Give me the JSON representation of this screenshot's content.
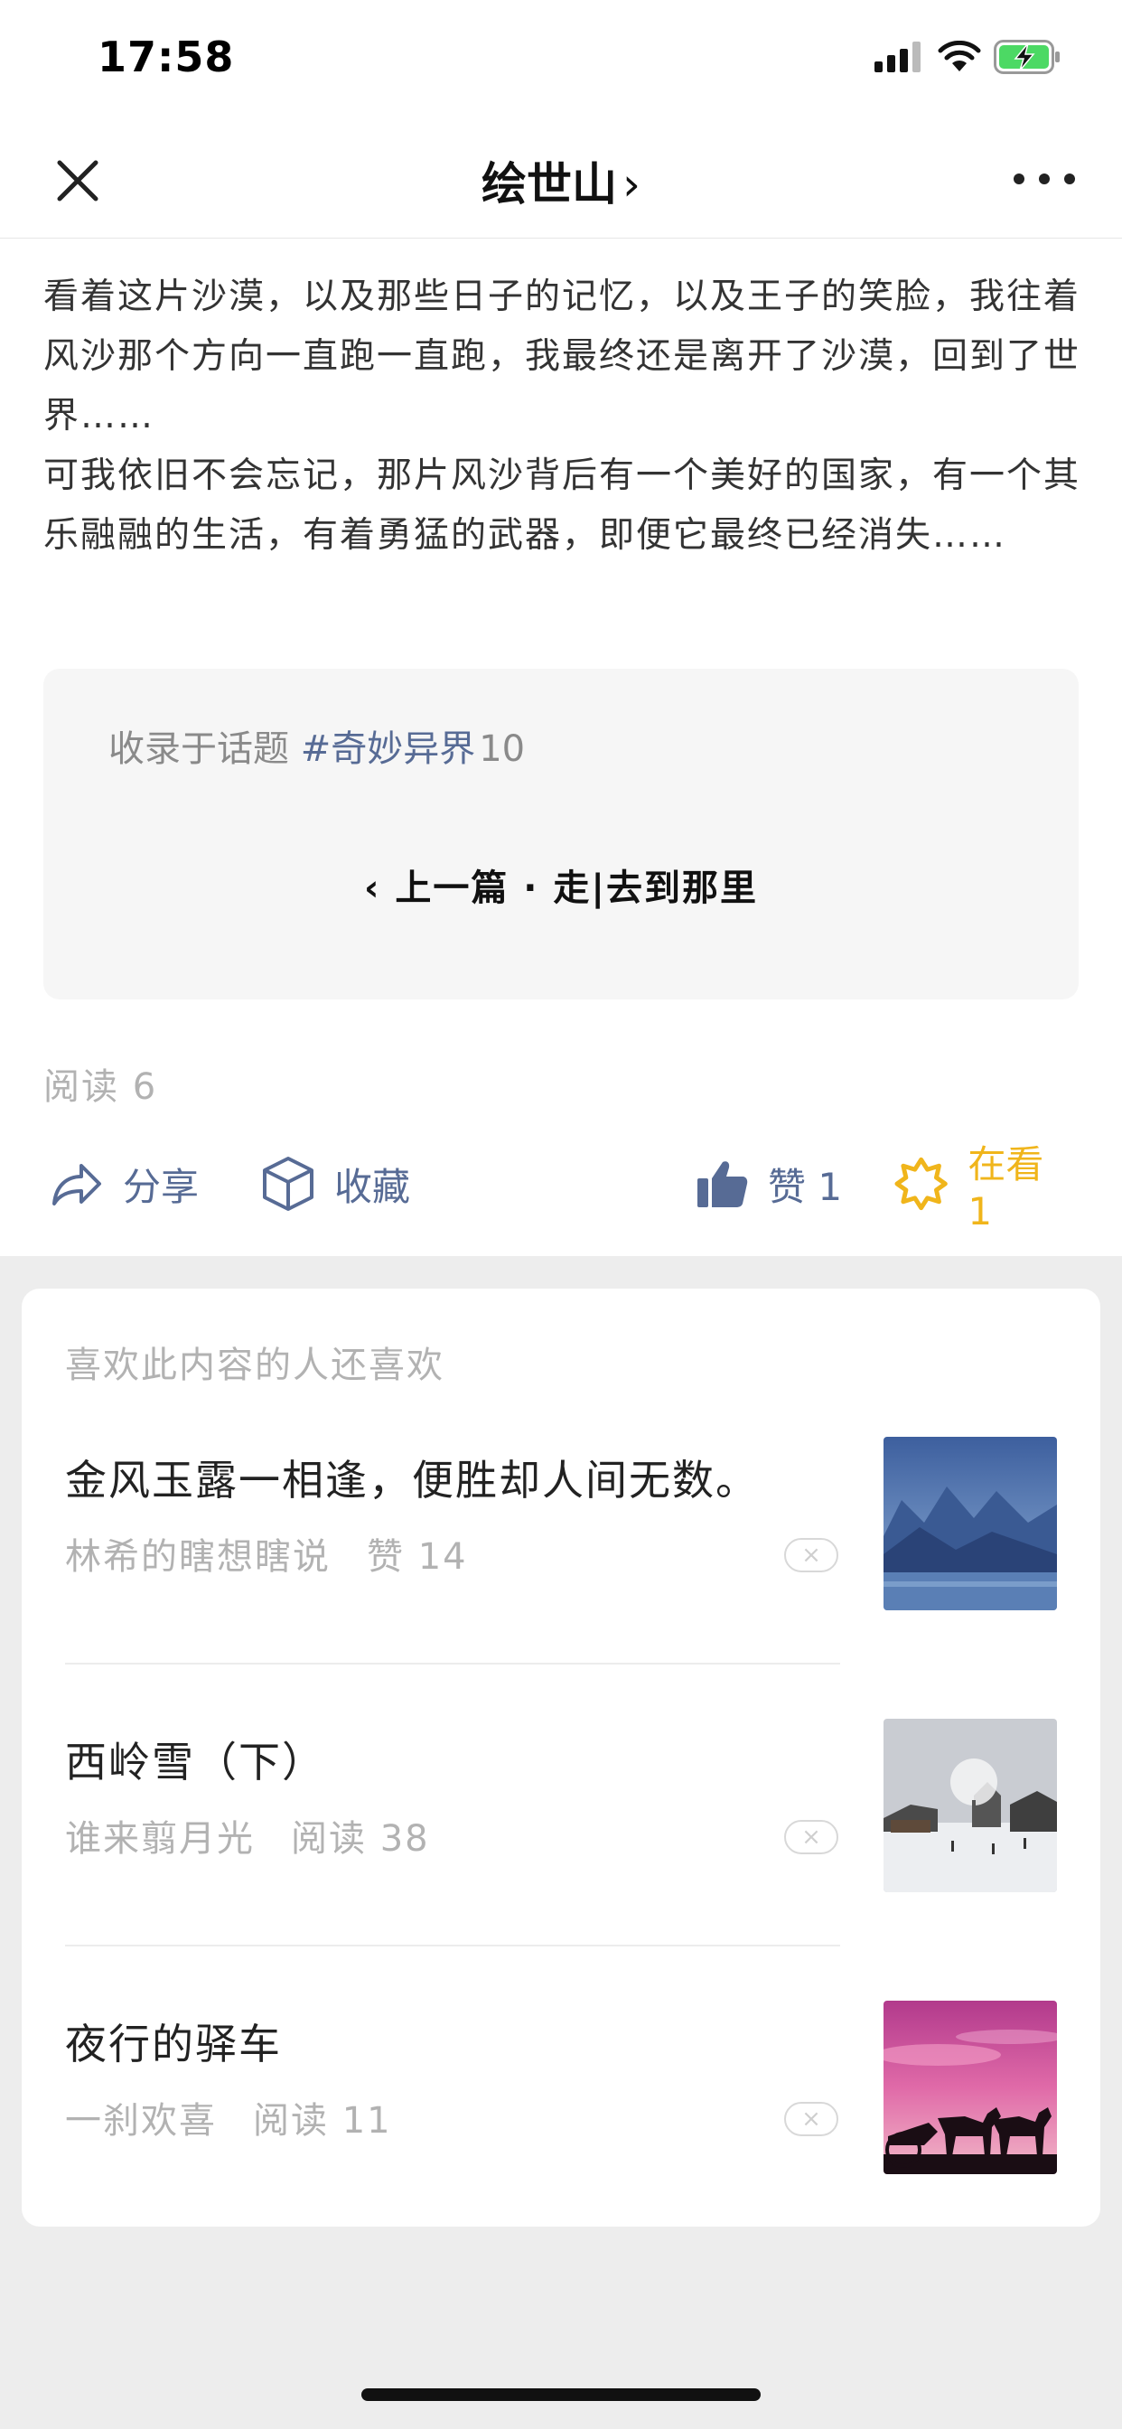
{
  "status_bar": {
    "time": "17:58"
  },
  "nav": {
    "title": "绘世山",
    "title_chevron": "›"
  },
  "article": {
    "paragraphs": [
      "看着这片沙漠，以及那些日子的记忆，以及王子的笑脸，我往着风沙那个方向一直跑一直跑，我最终还是离开了沙漠，回到了世界……",
      "可我依旧不会忘记，那片风沙背后有一个美好的国家，有一个其乐融融的生活，有着勇猛的武器，即便它最终已经消失……"
    ]
  },
  "topic_card": {
    "prefix": "收录于话题",
    "tag": "#奇妙异界",
    "count": "10",
    "prev_label": "‹ 上一篇 · 走|去到那里"
  },
  "read_count": "阅读 6",
  "actions": {
    "share": "分享",
    "collect": "收藏",
    "like": "赞 1",
    "watching": "在看 1"
  },
  "recommendations": {
    "heading": "喜欢此内容的人还喜欢",
    "items": [
      {
        "title": "金风玉露一相逢，便胜却人间无数。",
        "author": "林希的瞎想瞎说",
        "stat": "赞 14",
        "thumb": "mountain-lake-photo"
      },
      {
        "title": "西岭雪（下）",
        "author": "谁来翦月光",
        "stat": "阅读 38",
        "thumb": "snow-village-photo"
      },
      {
        "title": "夜行的驿车",
        "author": "一刹欢喜",
        "stat": "阅读 11",
        "thumb": "sunset-carriage-photo"
      }
    ],
    "dismiss_glyph": "×"
  },
  "colors": {
    "link_blue": "#576b95",
    "watch_gold": "#f0b51b",
    "battery_green": "#4cd964"
  }
}
